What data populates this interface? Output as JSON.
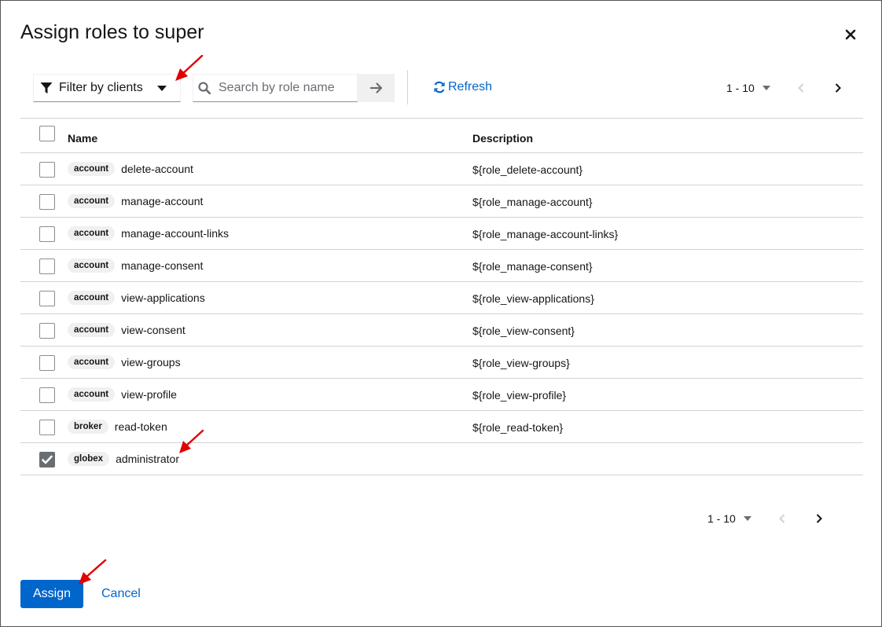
{
  "modal": {
    "title": "Assign roles to super",
    "close_icon": "close-icon"
  },
  "toolbar": {
    "filter_label": "Filter by clients",
    "search_placeholder": "Search by role name",
    "refresh_label": "Refresh",
    "pagination_range": "1 - 10"
  },
  "table": {
    "columns": [
      "Name",
      "Description"
    ],
    "rows": [
      {
        "client": "account",
        "name": "delete-account",
        "description": "${role_delete-account}",
        "checked": false
      },
      {
        "client": "account",
        "name": "manage-account",
        "description": "${role_manage-account}",
        "checked": false
      },
      {
        "client": "account",
        "name": "manage-account-links",
        "description": "${role_manage-account-links}",
        "checked": false
      },
      {
        "client": "account",
        "name": "manage-consent",
        "description": "${role_manage-consent}",
        "checked": false
      },
      {
        "client": "account",
        "name": "view-applications",
        "description": "${role_view-applications}",
        "checked": false
      },
      {
        "client": "account",
        "name": "view-consent",
        "description": "${role_view-consent}",
        "checked": false
      },
      {
        "client": "account",
        "name": "view-groups",
        "description": "${role_view-groups}",
        "checked": false
      },
      {
        "client": "account",
        "name": "view-profile",
        "description": "${role_view-profile}",
        "checked": false
      },
      {
        "client": "broker",
        "name": "read-token",
        "description": "${role_read-token}",
        "checked": false
      },
      {
        "client": "globex",
        "name": "administrator",
        "description": "",
        "checked": true
      }
    ]
  },
  "bottom_pagination": {
    "range": "1 - 10"
  },
  "footer": {
    "assign_label": "Assign",
    "cancel_label": "Cancel"
  },
  "colors": {
    "primary": "#0066cc",
    "annotation_arrow": "#e00000"
  }
}
